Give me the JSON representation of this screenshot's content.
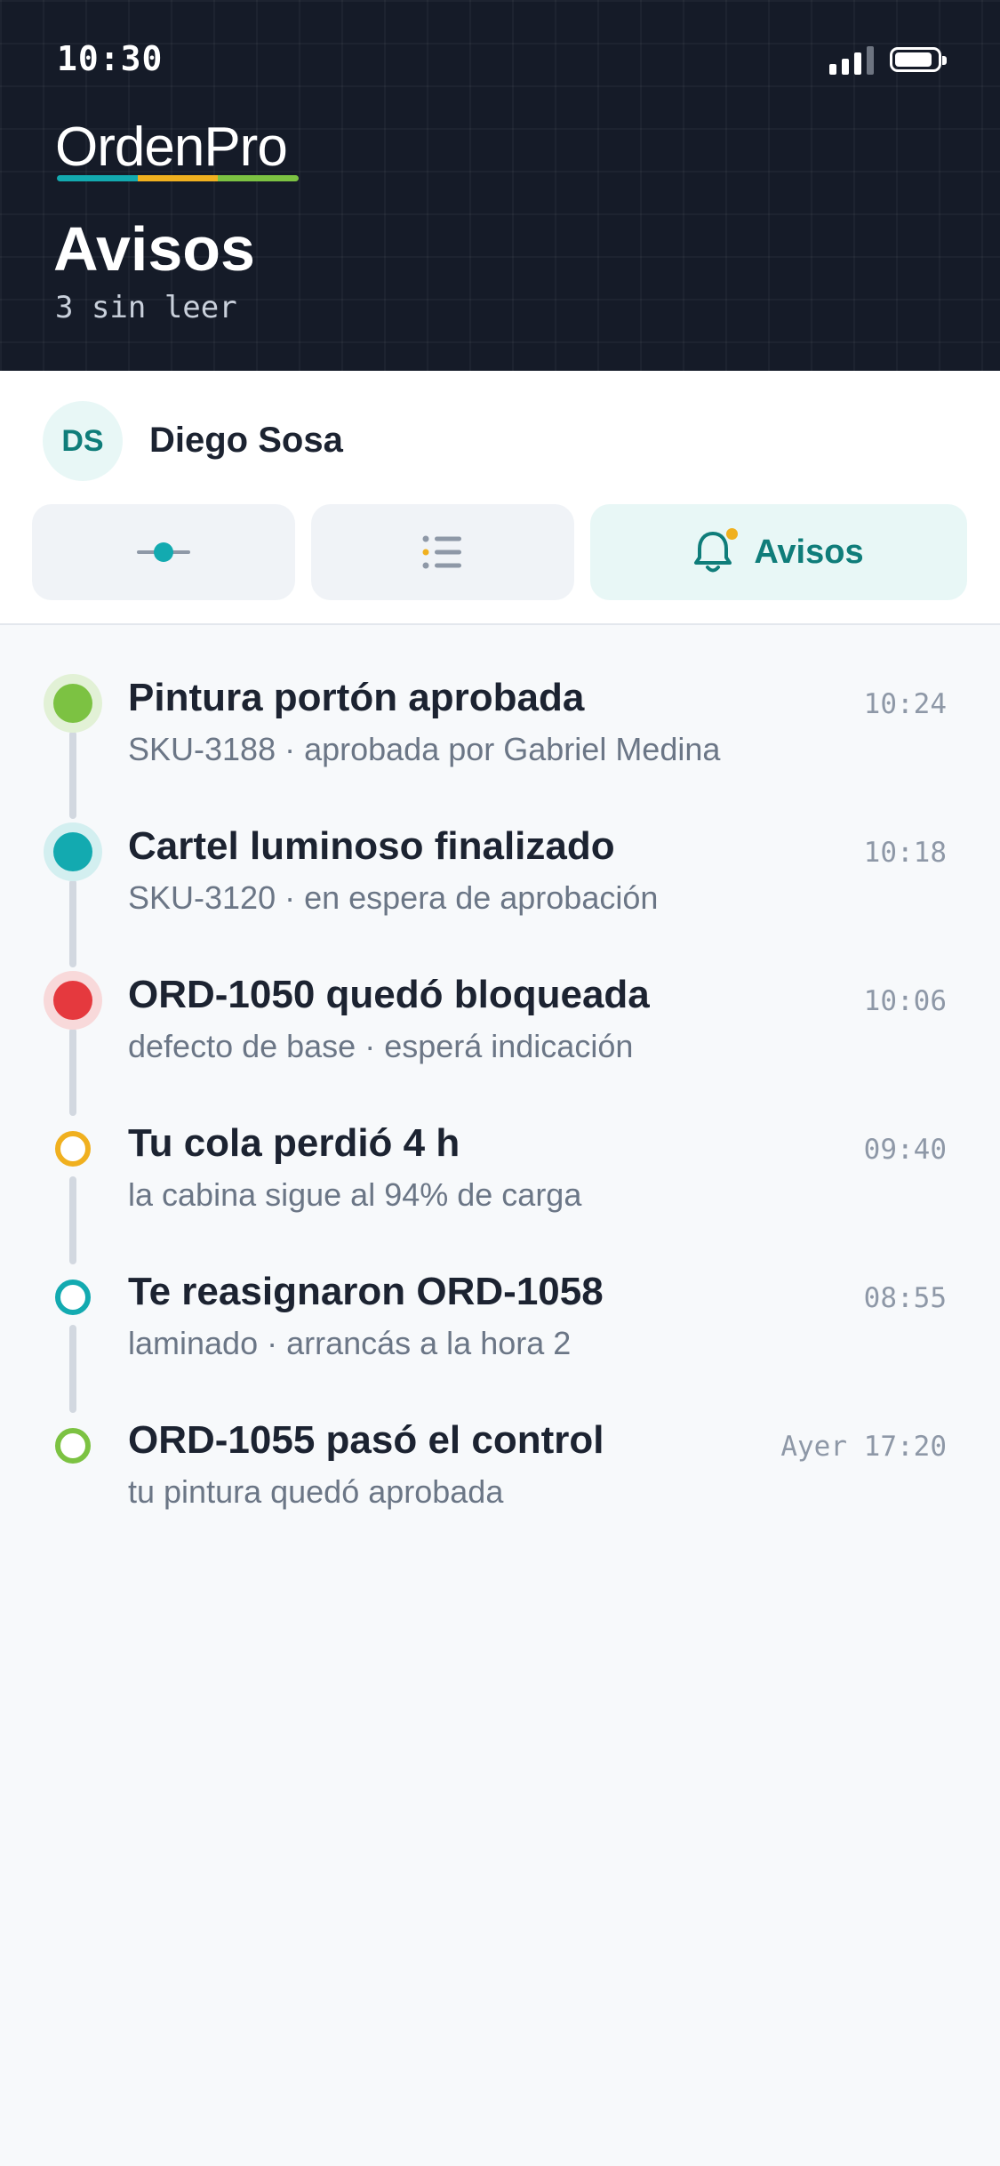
{
  "status_bar": {
    "time": "10:30"
  },
  "header": {
    "logo": "OrdenPro",
    "title": "Avisos",
    "subtitle": "3 sin leer"
  },
  "user": {
    "initials": "DS",
    "name": "Diego Sosa"
  },
  "tabs": {
    "items": [
      {
        "icon": "timeline-dot-icon",
        "label": ""
      },
      {
        "icon": "list-icon",
        "label": ""
      },
      {
        "icon": "bell-icon",
        "label": "Avisos",
        "active": true
      }
    ]
  },
  "colors": {
    "teal": "#13aab0",
    "green": "#7cc242",
    "red": "#e5393e",
    "yellow": "#f0b01f",
    "dark": "#151b28"
  },
  "notifications": [
    {
      "title": "Pintura portón aprobada",
      "subtitle": "SKU-3188 · aprobada por Gabriel Medina",
      "time": "10:24",
      "color": "#7cc242",
      "halo": "#e2f1d6",
      "unread": true
    },
    {
      "title": "Cartel luminoso finalizado",
      "subtitle": "SKU-3120 · en espera de aprobación",
      "time": "10:18",
      "color": "#13aab0",
      "halo": "#d3eff0",
      "unread": true
    },
    {
      "title": "ORD-1050 quedó bloqueada",
      "subtitle": "defecto de base · esperá indicación",
      "time": "10:06",
      "color": "#e5393e",
      "halo": "#f8d9da",
      "unread": true
    },
    {
      "title": "Tu cola perdió 4 h",
      "subtitle": "la cabina sigue al 94% de carga",
      "time": "09:40",
      "color": "#f0b01f",
      "unread": false
    },
    {
      "title": "Te reasignaron ORD-1058",
      "subtitle": "laminado · arrancás a la hora 2",
      "time": "08:55",
      "color": "#13aab0",
      "unread": false
    },
    {
      "title": "ORD-1055 pasó el control",
      "subtitle": "tu pintura quedó aprobada",
      "time": "Ayer 17:20",
      "color": "#7cc242",
      "unread": false
    }
  ]
}
